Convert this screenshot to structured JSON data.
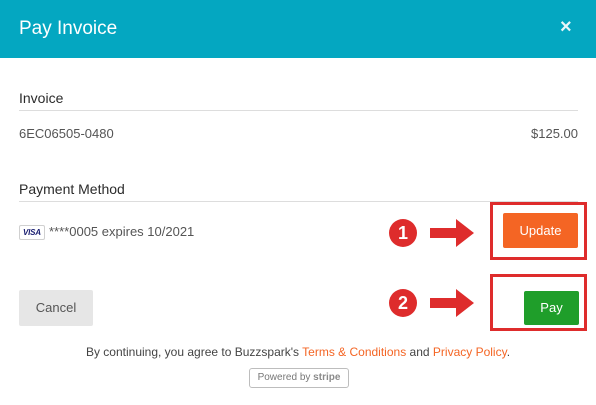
{
  "modal": {
    "title": "Pay Invoice",
    "close_label": "×"
  },
  "invoice": {
    "label": "Invoice",
    "number": "6EC06505-0480",
    "amount": "$125.00"
  },
  "payment_method": {
    "label": "Payment Method",
    "card_brand": "VISA",
    "card_text": "****0005 expires 10/2021"
  },
  "buttons": {
    "update": "Update",
    "cancel": "Cancel",
    "pay": "Pay"
  },
  "annotations": {
    "step1": "1",
    "step2": "2",
    "color": "#de2c2c"
  },
  "footer": {
    "prefix": "By continuing, you agree to Buzzspark's ",
    "terms": "Terms & Conditions",
    "middle": " and ",
    "privacy": "Privacy Policy",
    "suffix": ".",
    "powered_by": "Powered by",
    "stripe": "stripe"
  },
  "colors": {
    "header": "#04a7c1",
    "update_button": "#f46524",
    "pay_button": "#1f9e2a",
    "link": "#f46524"
  }
}
